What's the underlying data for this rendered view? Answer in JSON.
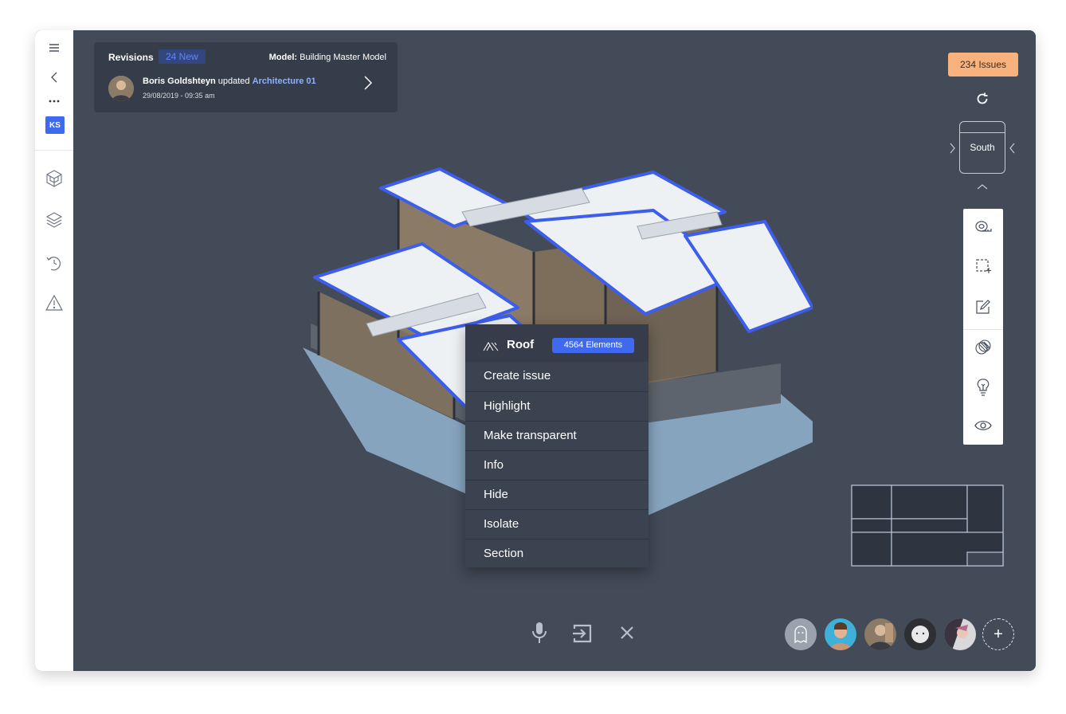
{
  "sidebar": {
    "initials": "KS",
    "items": [
      {
        "icon": "hamburger-menu-icon"
      },
      {
        "icon": "back-chevron-icon"
      },
      {
        "icon": "more-dots-icon"
      },
      {
        "icon": "model-cube-icon"
      },
      {
        "icon": "layers-icon"
      },
      {
        "icon": "history-icon"
      },
      {
        "icon": "warning-icon"
      }
    ]
  },
  "revisions": {
    "title": "Revisions",
    "new_badge": "24 New",
    "model_label": "Model:",
    "model_name": "Building Master Model",
    "entry": {
      "user": "Boris Goldshteyn",
      "action": "updated",
      "target": "Architecture 01",
      "datetime": "29/08/2019 - 09:35 am"
    }
  },
  "issues_button": "234 Issues",
  "view_cube": {
    "face": "South"
  },
  "tools": [
    {
      "icon": "measure-tape-icon"
    },
    {
      "icon": "selection-box-icon"
    },
    {
      "icon": "markup-pencil-icon"
    },
    {
      "icon": "xray-material-icon"
    },
    {
      "icon": "lightbulb-icon"
    },
    {
      "icon": "eye-icon"
    }
  ],
  "context_menu": {
    "title": "Roof",
    "badge": "4564 Elements",
    "items": [
      "Create issue",
      "Highlight",
      "Make transparent",
      "Info",
      "Hide",
      "Isolate",
      "Section"
    ]
  },
  "bottom_tools": [
    {
      "icon": "microphone-icon"
    },
    {
      "icon": "exit-session-icon"
    },
    {
      "icon": "close-icon"
    }
  ],
  "participants": [
    {
      "type": "ghost"
    },
    {
      "type": "user"
    },
    {
      "type": "user"
    },
    {
      "type": "user"
    },
    {
      "type": "user"
    }
  ],
  "add_participant": "+",
  "colors": {
    "accent": "#3f6af0",
    "issues": "#f7b27e",
    "viewport": "#434a58",
    "selection_outline": "#3d5eea"
  }
}
